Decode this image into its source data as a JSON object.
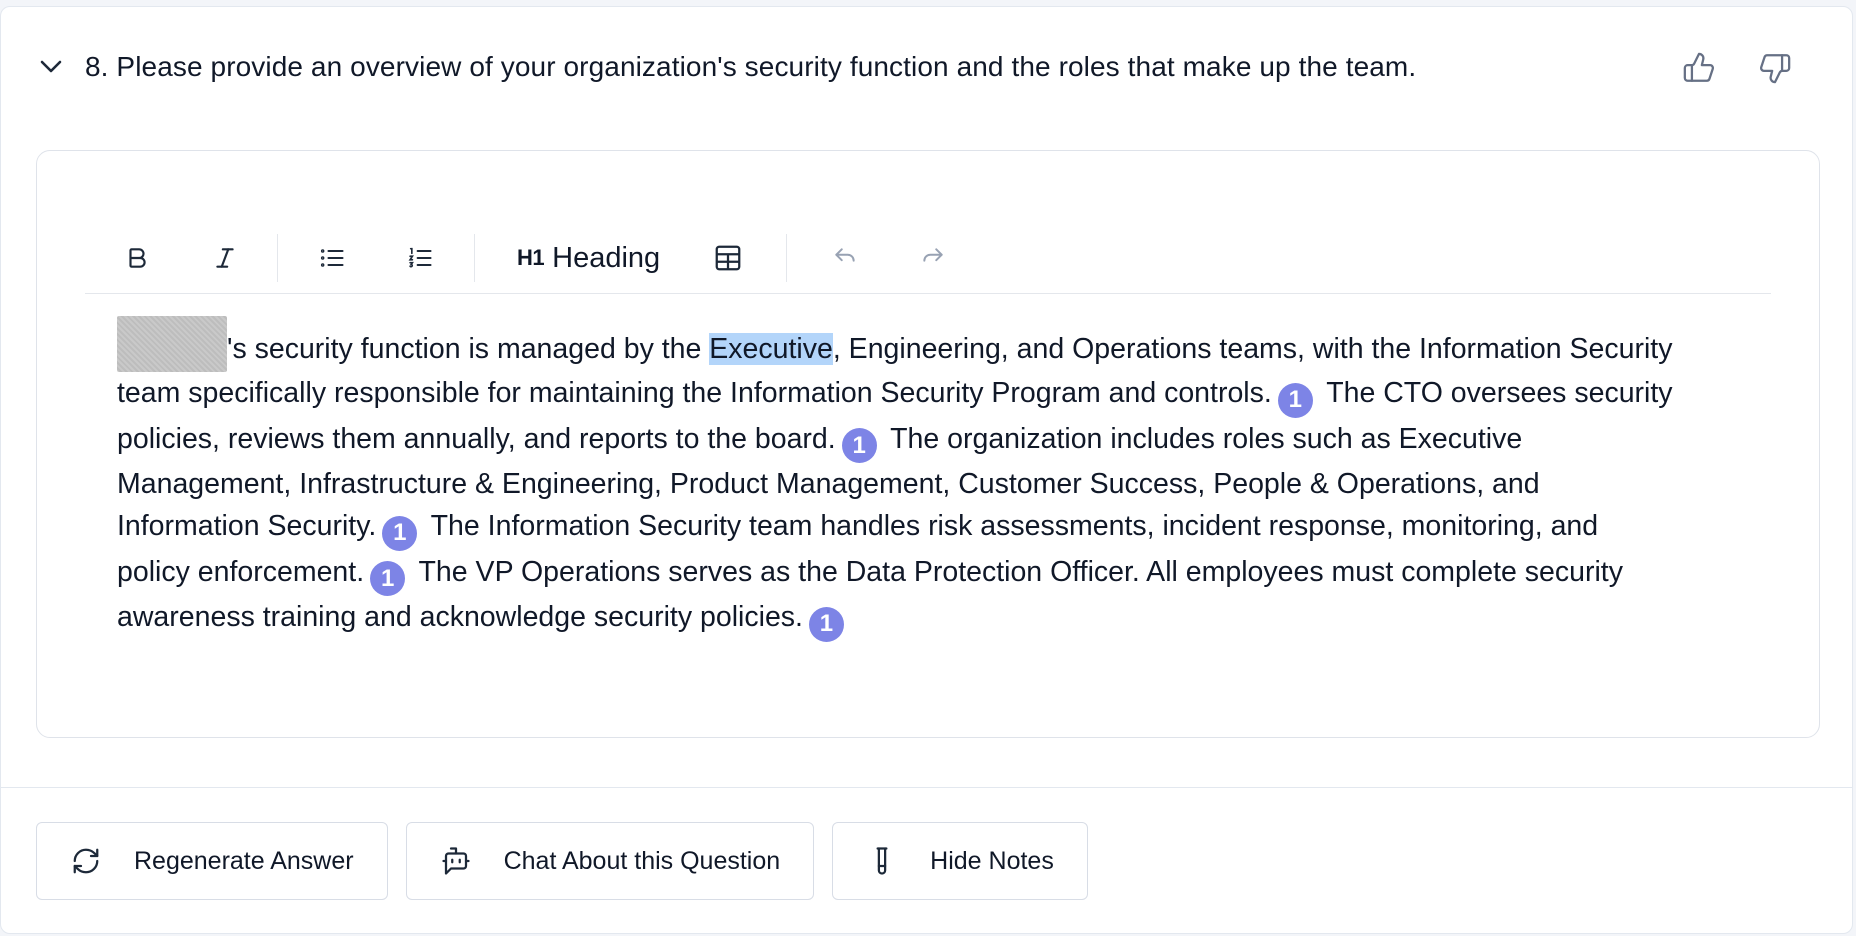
{
  "question": {
    "title": "8. Please provide an overview of your organization's security function and the roles that make up the team.",
    "icons": {
      "collapse": "chevron-down-icon",
      "like": "thumbs-up-icon",
      "dislike": "thumbs-down-icon"
    }
  },
  "toolbar": {
    "heading_prefix": "H1",
    "heading_label": "Heading",
    "icons": [
      "bold-icon",
      "italic-icon",
      "bullet-list-icon",
      "numbered-list-icon",
      "table-icon",
      "undo-icon",
      "redo-icon"
    ]
  },
  "answer": {
    "segments": [
      "'s security function is managed by the ",
      "Executive",
      ", Engineering, and Operations teams, with the Information Security team specifically responsible for maintaining the Information Security Program and controls.",
      " The CTO oversees security policies, reviews them annually, and reports to the board.",
      " The organization includes roles such as Executive Management, Infrastructure & Engineering, Product Management, Customer Success, People & Operations, and Information Security.",
      " The Information Security team handles risk assessments, incident response, monitoring, and policy enforcement.",
      " The VP Operations serves as the Data Protection Officer. All employees must complete security awareness training and acknowledge security policies."
    ],
    "citations": [
      "1",
      "1",
      "1",
      "1",
      "1"
    ],
    "citation_color": "#7d84e6",
    "highlight_color": "#b3d5fa"
  },
  "actions": {
    "regenerate": "Regenerate Answer",
    "chat": "Chat About this Question",
    "hide_notes": "Hide Notes"
  }
}
